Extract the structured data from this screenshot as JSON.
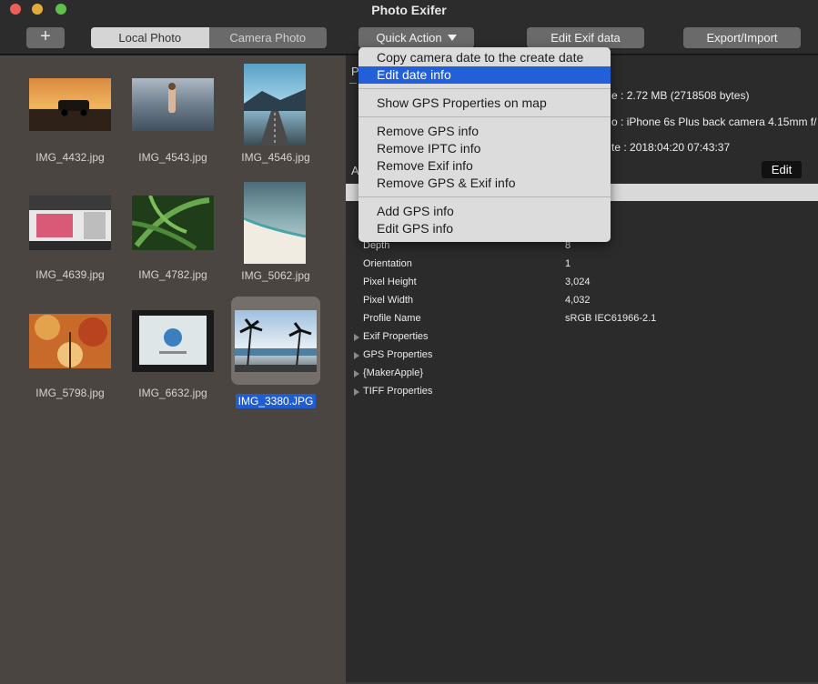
{
  "window": {
    "title": "Photo Exifer"
  },
  "toolbar": {
    "add_label": "+",
    "source_tabs": [
      "Local Photo",
      "Camera Photo"
    ],
    "quick_action_label": "Quick Action",
    "edit_exif_label": "Edit Exif data",
    "export_label": "Export/Import"
  },
  "photos": [
    "IMG_4432.jpg",
    "IMG_4543.jpg",
    "IMG_4546.jpg",
    "IMG_4639.jpg",
    "IMG_4782.jpg",
    "IMG_5062.jpg",
    "IMG_5798.jpg",
    "IMG_6632.jpg",
    "IMG_3380.JPG"
  ],
  "selected_photo": "IMG_3380.JPG",
  "info": {
    "header_p": "P",
    "header_a": "A",
    "size_label": "e :",
    "size_value": "2.72 MB (2718508 bytes)",
    "model_label": "o :",
    "model_value": "iPhone 6s Plus back camera 4.15mm f/",
    "date_label": "te :",
    "date_value": "2018:04:20 07:43:37",
    "edit_label": "Edit"
  },
  "properties": [
    {
      "key": "Depth",
      "value": "8"
    },
    {
      "key": "Orientation",
      "value": "1"
    },
    {
      "key": "Pixel Height",
      "value": "3,024"
    },
    {
      "key": "Pixel Width",
      "value": "4,032"
    },
    {
      "key": "Profile Name",
      "value": "sRGB IEC61966-2.1"
    }
  ],
  "groups": [
    "Exif Properties",
    "GPS Properties",
    "{MakerApple}",
    "TIFF Properties"
  ],
  "menu": {
    "items": [
      "Copy camera date to the create date",
      "Edit date info",
      "Show GPS Properties on map",
      "Remove GPS info",
      "Remove IPTC info",
      "Remove Exif info",
      "Remove GPS & Exif info",
      "Add GPS info",
      "Edit GPS  info"
    ],
    "highlighted": "Edit date info"
  },
  "colors": {
    "accent": "#2160d8",
    "selection": "#1f5dd1"
  }
}
